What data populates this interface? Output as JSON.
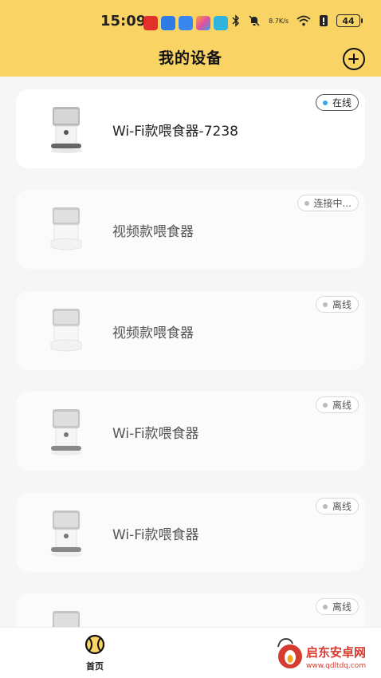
{
  "status_bar": {
    "time": "15:09",
    "network_speed_value": "8.7",
    "network_speed_unit": "K/s",
    "battery": "44"
  },
  "header": {
    "title": "我的设备"
  },
  "devices": [
    {
      "name": "Wi-Fi款喂食器-7238",
      "status": "在线",
      "online": true
    },
    {
      "name": "视频款喂食器",
      "status": "连接中...",
      "online": false
    },
    {
      "name": "视频款喂食器",
      "status": "离线",
      "online": false
    },
    {
      "name": "Wi-Fi款喂食器",
      "status": "离线",
      "online": false
    },
    {
      "name": "Wi-Fi款喂食器",
      "status": "离线",
      "online": false
    },
    {
      "name": "",
      "status": "离线",
      "online": false
    }
  ],
  "bottom_nav": {
    "home_label": "首页"
  },
  "watermark": {
    "brand": "启东安卓网",
    "url": "www.qdltdq.com"
  },
  "colors": {
    "header_bg": "#f9d465",
    "online_dot": "#3ba7e6",
    "offline_dot": "#bbbbbb",
    "watermark": "#d63b2f"
  }
}
